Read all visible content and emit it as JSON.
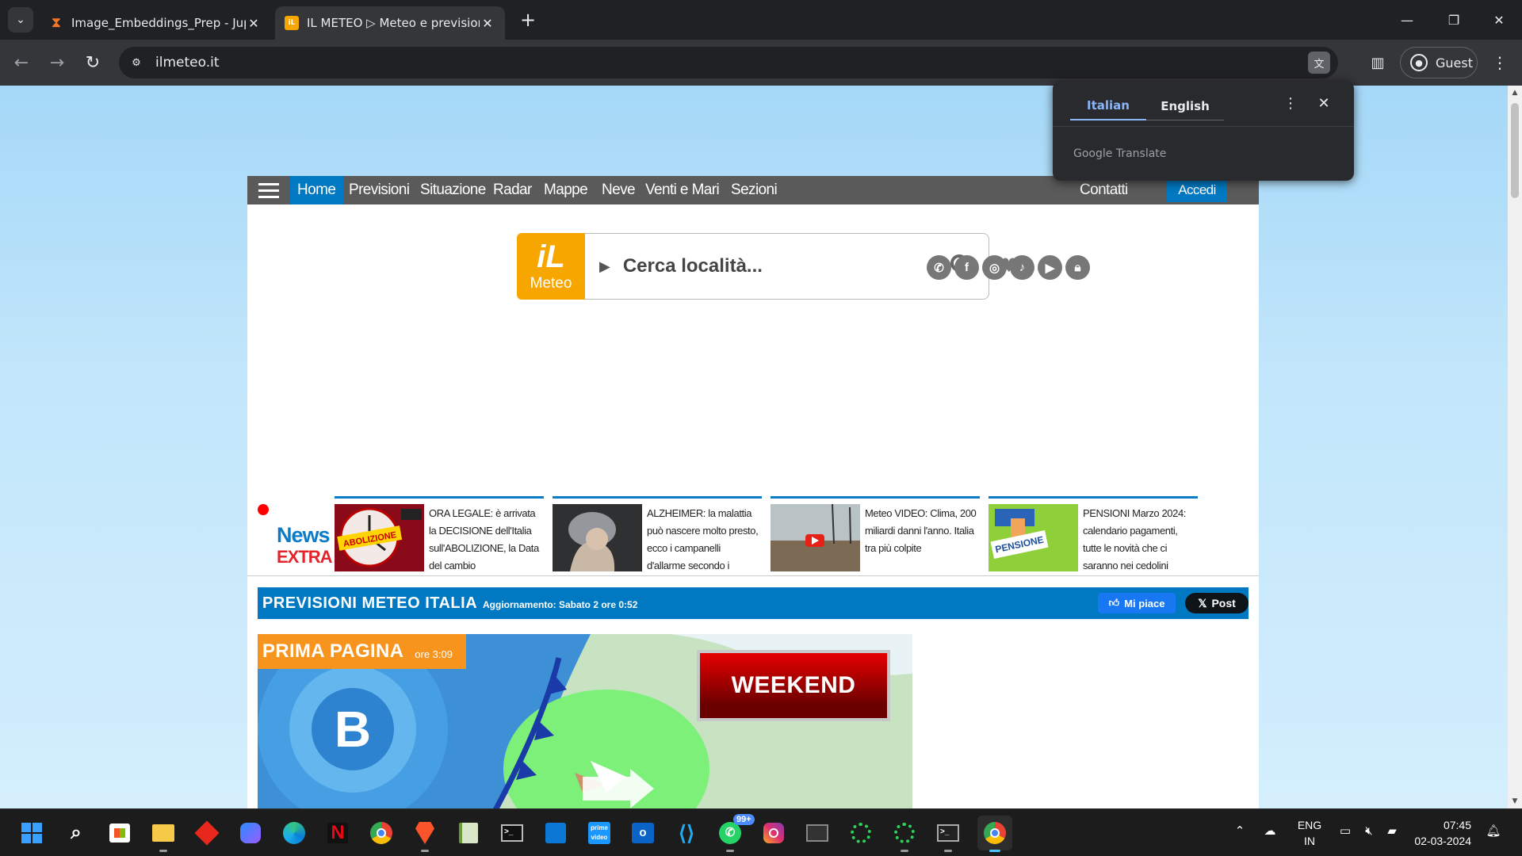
{
  "browser": {
    "tabs": [
      {
        "title": "Image_Embeddings_Prep - Jupy",
        "favicon": "jupyter-icon"
      },
      {
        "title": "IL METEO ▷ Meteo e previsioni",
        "favicon": "ilmeteo-icon"
      }
    ],
    "url": "ilmeteo.it",
    "profile_label": "Guest"
  },
  "translate_popup": {
    "lang_source": "Italian",
    "lang_target": "English",
    "brand": "Google Translate"
  },
  "site": {
    "nav": {
      "items": [
        "Home",
        "Previsioni",
        "Situazione",
        "Radar",
        "Mappe",
        "Neve",
        "Venti e Mari",
        "Sezioni"
      ],
      "contatti": "Contatti",
      "accedi": "Accedi",
      "accent_color": "#0079c2"
    },
    "logo": {
      "line1": "iL",
      "line2": "Meteo"
    },
    "search": {
      "placeholder": "Cerca località..."
    },
    "social_icons": [
      "whatsapp-icon",
      "facebook-icon",
      "instagram-icon",
      "tiktok-icon",
      "youtube-icon",
      "lock-icon"
    ],
    "news": {
      "title": "News",
      "subtitle": "EXTRA",
      "cards": [
        {
          "text": "ORA LEGALE: è arrivata la DECISIONE dell'Italia sull'ABOLIZIONE, la Data del cambio",
          "thumb_label": "ABOLIZIONE"
        },
        {
          "text": "ALZHEIMER: la malattia può nascere molto presto, ecco i campanelli d'allarme secondo i"
        },
        {
          "text": "Meteo VIDEO: Clima, 200 miliardi danni l'anno. Italia tra più colpite"
        },
        {
          "text": "PENSIONI Marzo 2024: calendario pagamenti, tutte le novità che ci saranno nei cedolini",
          "thumb_label": "PENSIONE"
        }
      ]
    },
    "previsioni": {
      "title": "PREVISIONI METEO ITALIA",
      "update": "Aggiornamento: Sabato 2 ore 0:52",
      "fb_label": "Mi piace",
      "x_label": "Post"
    },
    "prima_pagina": {
      "label": "PRIMA PAGINA",
      "time": "ore 3:09",
      "banner": "WEEKEND",
      "pressure_label": "B"
    }
  },
  "taskbar": {
    "apps": [
      "start-icon",
      "search-icon",
      "store-icon",
      "file-explorer-icon",
      "app-red-icon",
      "copilot-icon",
      "edge-icon",
      "netflix-icon",
      "chrome-icon",
      "brave-icon",
      "notepad-icon",
      "terminal-icon",
      "windows-app-icon",
      "prime-video-icon",
      "outlook-icon",
      "vscode-icon",
      "whatsapp-icon",
      "instagram-icon",
      "app-window-icon",
      "spinner-icon",
      "spinner-icon-2",
      "cmd-icon",
      "chrome-active-icon"
    ],
    "whatsapp_badge": "99+",
    "language": {
      "line1": "ENG",
      "line2": "IN"
    },
    "clock": {
      "time": "07:45",
      "date": "02-03-2024"
    }
  }
}
